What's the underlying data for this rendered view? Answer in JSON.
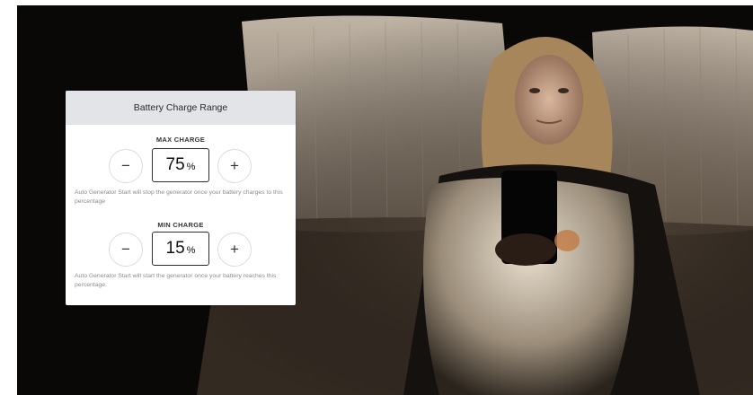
{
  "panel": {
    "title": "Battery Charge Range",
    "max": {
      "label": "MAX CHARGE",
      "value": "75",
      "unit": "%",
      "minus": "−",
      "plus": "+",
      "help": "Auto Generator Start will stop the generator once your battery charges to this percentage"
    },
    "min": {
      "label": "MIN CHARGE",
      "value": "15",
      "unit": "%",
      "minus": "−",
      "plus": "+",
      "help": "Auto Generator Start will start the generator once your battery reaches this percentage."
    }
  },
  "colors": {
    "header_bg": "#e3e4e8",
    "photo_bg": "#0a0807",
    "help_text": "#8c8c8c"
  },
  "icons": [
    "minus-icon",
    "plus-icon"
  ]
}
